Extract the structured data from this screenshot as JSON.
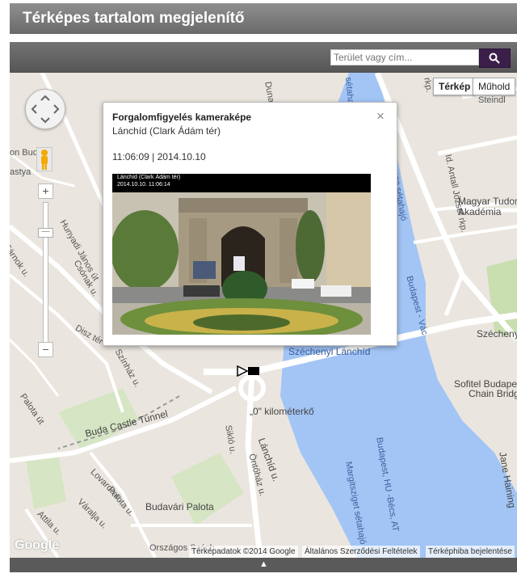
{
  "header": {
    "title": "Térképes tartalom megjelenítő"
  },
  "search": {
    "placeholder": "Terület vagy cím..."
  },
  "map": {
    "type_buttons": [
      "Térkép",
      "Műhold"
    ],
    "labels": {
      "budai_also_rkp": "rkp.",
      "id_antall": "Id. Antall József rkp.",
      "steindl": "Steindl",
      "magyar_tud": "Magyar Tudom",
      "akademia": "Akadémia",
      "szechenyi_is": "Széchenyi Is",
      "szechenyi_lanchid": "Széchenyi Lánchíd",
      "sofitel1": "Sofitel Budapes",
      "sofitel2": "Chain Bridge",
      "nulla_km": "„0\" kilométerkő",
      "buda_tunnel": "Buda Castle Tunnel",
      "budavari_palota": "Budavári Palota",
      "orszagos_szech": "Országos Széch",
      "budapest_vac": "Budapest - Vác",
      "budapest_hu_becs": "Budapest, HU -Bécs, AT",
      "margitsziget": "Margitsziget sétahajó",
      "lanchid_u": "Lánchíd u.",
      "ontohaz_u": "Öntőház u.",
      "palota_ut": "Palota út",
      "disz_ter": "Disz tér",
      "szinhaz_u": "Színház u.",
      "hunyadi_janos": "Hunyadi János út",
      "tarnok_u": "Tárnok u.",
      "csonak_u": "Csónak u.",
      "lovarda_u": "Lovarda u.",
      "varalja_u": "Váralja u.",
      "attila_u": "Attila u.",
      "palota_u": "Palota u.",
      "on_bud": "on Bud",
      "astya": "astya",
      "duna_co": "Duna Co",
      "setahajo_top": "sétahajó",
      "frasso": "Frasso sétahajó",
      "jane": "Jane Haining",
      "sikio": "Sikló u."
    },
    "copyright": [
      "Térképadatok ©2014 Google",
      "Általános Szerződési Feltételek",
      "Térképhiba bejelentése"
    ],
    "google_logo": "Google"
  },
  "popup": {
    "title": "Forgalomfigyelés kameraképe",
    "subtitle": "Lánchíd (Clark Ádám tér)",
    "timestamp": "11:06:09 | 2014.10.10",
    "close": "×",
    "camera_overlay_line1": "Lánchíd (Clark Ádám tér)",
    "camera_overlay_line2": "2014.10.10. 11:06:14"
  },
  "bottom": {
    "arrow": "▲"
  },
  "colors": {
    "water": "#a3c5f5",
    "land": "#eae6df",
    "road": "#ffffff",
    "park": "#c9dfb0",
    "header": "#7a7a7a"
  }
}
